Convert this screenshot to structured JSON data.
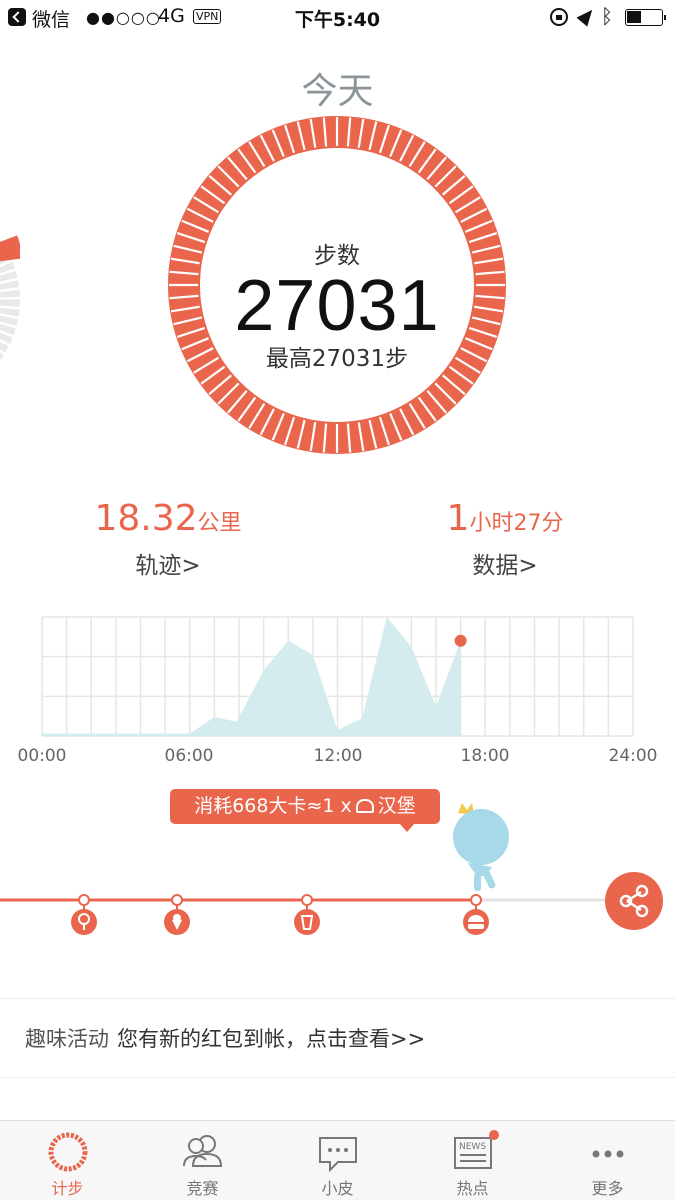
{
  "status_bar": {
    "app_back_label": "微信",
    "signal": "●●○○○",
    "network": "4G",
    "vpn": "VPN",
    "time": "下午5:40"
  },
  "title": "今天",
  "steps": {
    "label": "步数",
    "value": "27031",
    "best": "最高27031步"
  },
  "stats": {
    "distance_value": "18.32",
    "distance_unit": "公里",
    "track_link": "轨迹>",
    "duration_hours": "1",
    "duration_hours_unit": "小时",
    "duration_minutes": "27",
    "duration_minutes_unit": "分",
    "data_link": "数据>"
  },
  "colors": {
    "accent": "#e9664d",
    "chart_fill": "#d4ecee",
    "grid": "#e6e6e6",
    "text_gray": "#8a9499"
  },
  "chart_data": {
    "type": "area",
    "x_ticks": [
      "00:00",
      "06:00",
      "12:00",
      "18:00",
      "24:00"
    ],
    "x_hours": [
      0,
      6,
      7,
      7.9,
      9,
      10,
      11,
      12,
      13,
      14,
      15,
      16,
      17
    ],
    "values": [
      2,
      2,
      16,
      12,
      55,
      80,
      68,
      5,
      15,
      100,
      75,
      25,
      80
    ],
    "xlim": [
      0,
      24
    ],
    "ylim": [
      0,
      100
    ],
    "grid": true,
    "current_point_hour": 17
  },
  "calories": {
    "text_prefix": "消耗668大卡≈1 x",
    "food": "汉堡",
    "milestones": [
      "lollipop-icon",
      "ice-cream-icon",
      "drink-icon",
      "burger-icon"
    ]
  },
  "promo": {
    "tag": "趣味活动",
    "text": "您有新的红包到帐，点击查看>>"
  },
  "tabs": [
    {
      "label": "计步",
      "icon": "ring-icon",
      "active": true
    },
    {
      "label": "竞赛",
      "icon": "people-icon",
      "active": false
    },
    {
      "label": "小皮",
      "icon": "chat-icon",
      "active": false
    },
    {
      "label": "热点",
      "icon": "news-icon",
      "active": false,
      "badge": true
    },
    {
      "label": "更多",
      "icon": "more-icon",
      "active": false
    }
  ]
}
